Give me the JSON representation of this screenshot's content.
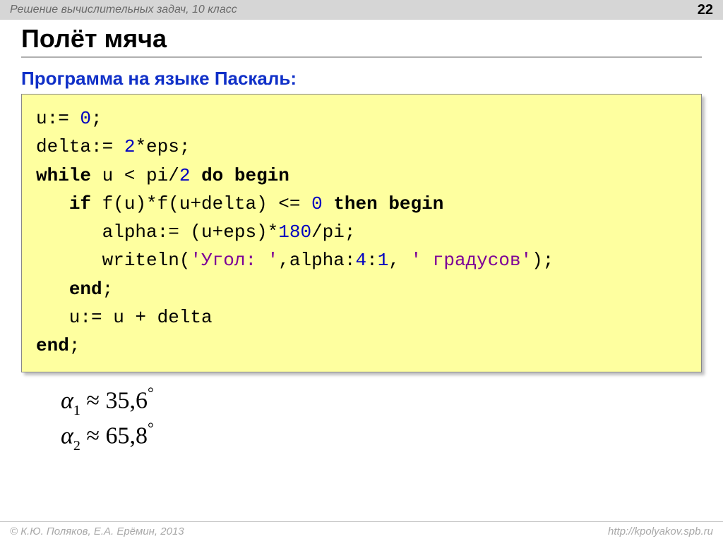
{
  "header": {
    "course": "Решение  вычислительных задач, 10 класс",
    "page": "22"
  },
  "title": "Полёт мяча",
  "subtitle": "Программа на языке Паскаль:",
  "code": {
    "l1_a": "u:= ",
    "l1_num": "0",
    "l1_b": ";",
    "l2_a": "delta:= ",
    "l2_num": "2",
    "l2_b": "*eps;",
    "l3_kw1": "while",
    "l3_a": " u < pi/",
    "l3_num": "2",
    "l3_b": " ",
    "l3_kw2": "do begin",
    "l4_a": "   ",
    "l4_kw1": "if",
    "l4_b": " f(u)*f(u+delta) <= ",
    "l4_num": "0",
    "l4_c": " ",
    "l4_kw2": "then begin",
    "l5_a": "      alpha:= (u+eps)*",
    "l5_num": "180",
    "l5_b": "/pi;",
    "l6_a": "      writeln(",
    "l6_str1": "'Угол: '",
    "l6_b": ",alpha:",
    "l6_num1": "4",
    "l6_c": ":",
    "l6_num2": "1",
    "l6_d": ", ",
    "l6_str2": "' градусов'",
    "l6_e": ");",
    "l7_a": "   ",
    "l7_kw": "end",
    "l7_b": ";",
    "l8_a": "   u:= u + delta",
    "l9_kw": "end",
    "l9_b": ";"
  },
  "results": {
    "r1": {
      "sym": "α",
      "sub": "1",
      "approx": " ≈ ",
      "val": "35,6",
      "deg": "°"
    },
    "r2": {
      "sym": "α",
      "sub": "2",
      "approx": " ≈ ",
      "val": "65,8",
      "deg": "°"
    }
  },
  "footer": {
    "left": "© К.Ю. Поляков, Е.А. Ерёмин, 2013",
    "right": "http://kpolyakov.spb.ru"
  }
}
